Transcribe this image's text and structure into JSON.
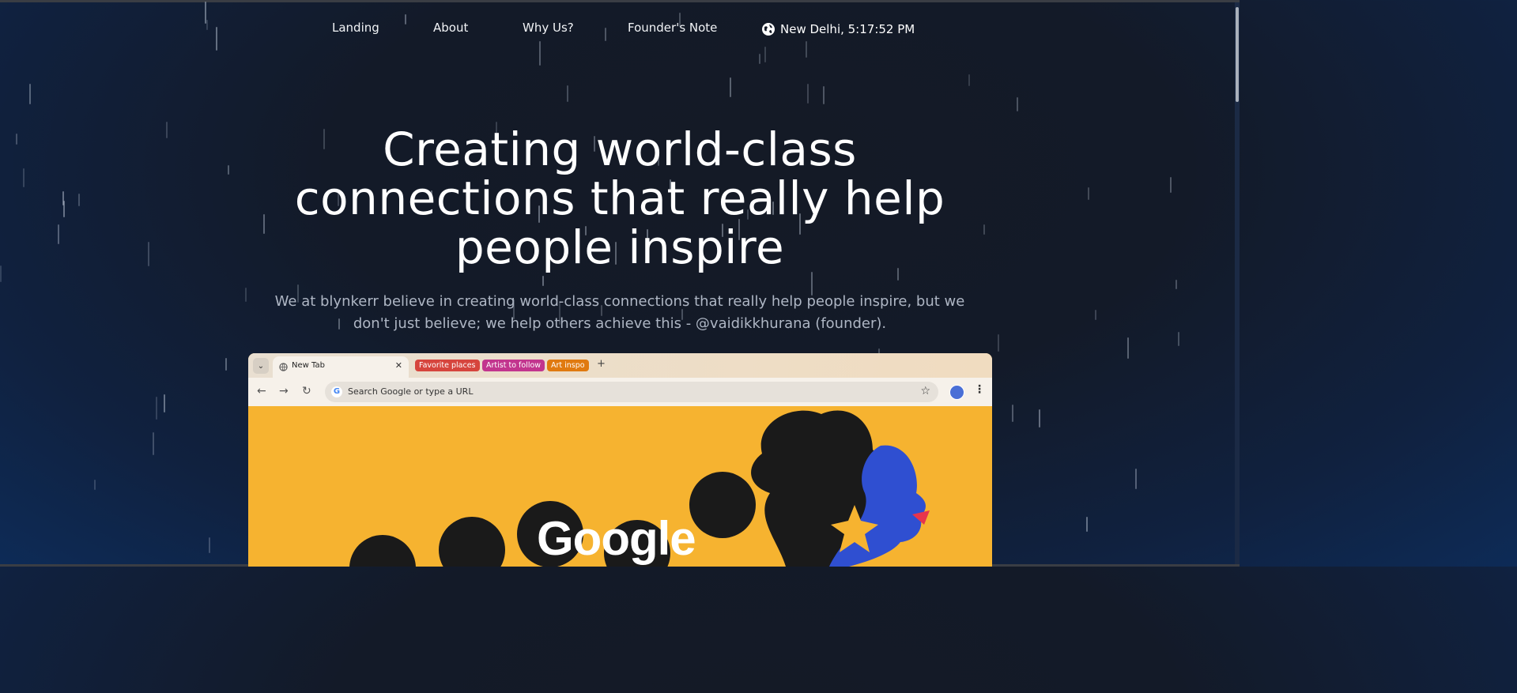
{
  "nav": {
    "links": [
      "Landing",
      "About",
      "Why Us?",
      "Founder's Note"
    ],
    "clock": "New Delhi, 5:17:52 PM"
  },
  "hero": {
    "title_lines": [
      "Creating world-class",
      "connections that really help",
      "people inspire"
    ],
    "subtitle_lines": [
      "We at blynkerr believe in creating world-class connections that really help people inspire, but we",
      "don't just believe; we help others achieve this - @vaidikkhurana (founder)."
    ]
  },
  "browser": {
    "tab_label": "New Tab",
    "groups": [
      {
        "label": "Favorite places",
        "color": "#d6453d"
      },
      {
        "label": "Artist to follow",
        "color": "#c2358e"
      },
      {
        "label": "Art inspo",
        "color": "#e07a10"
      }
    ],
    "omnibox_placeholder": "Search Google or type a URL",
    "doodle_word": "Google",
    "icons": [
      "chevron-down-icon",
      "globe-icon",
      "close-icon",
      "plus-icon",
      "back-icon",
      "forward-icon",
      "reload-icon",
      "google-icon",
      "star-icon",
      "avatar",
      "kebab-icon"
    ]
  },
  "colors": {
    "doodle_background": "#f6b330",
    "doodle_figure": "#1a1a1a",
    "doodle_face": "#2f4fd1",
    "doodle_lips": "#e8344c"
  }
}
